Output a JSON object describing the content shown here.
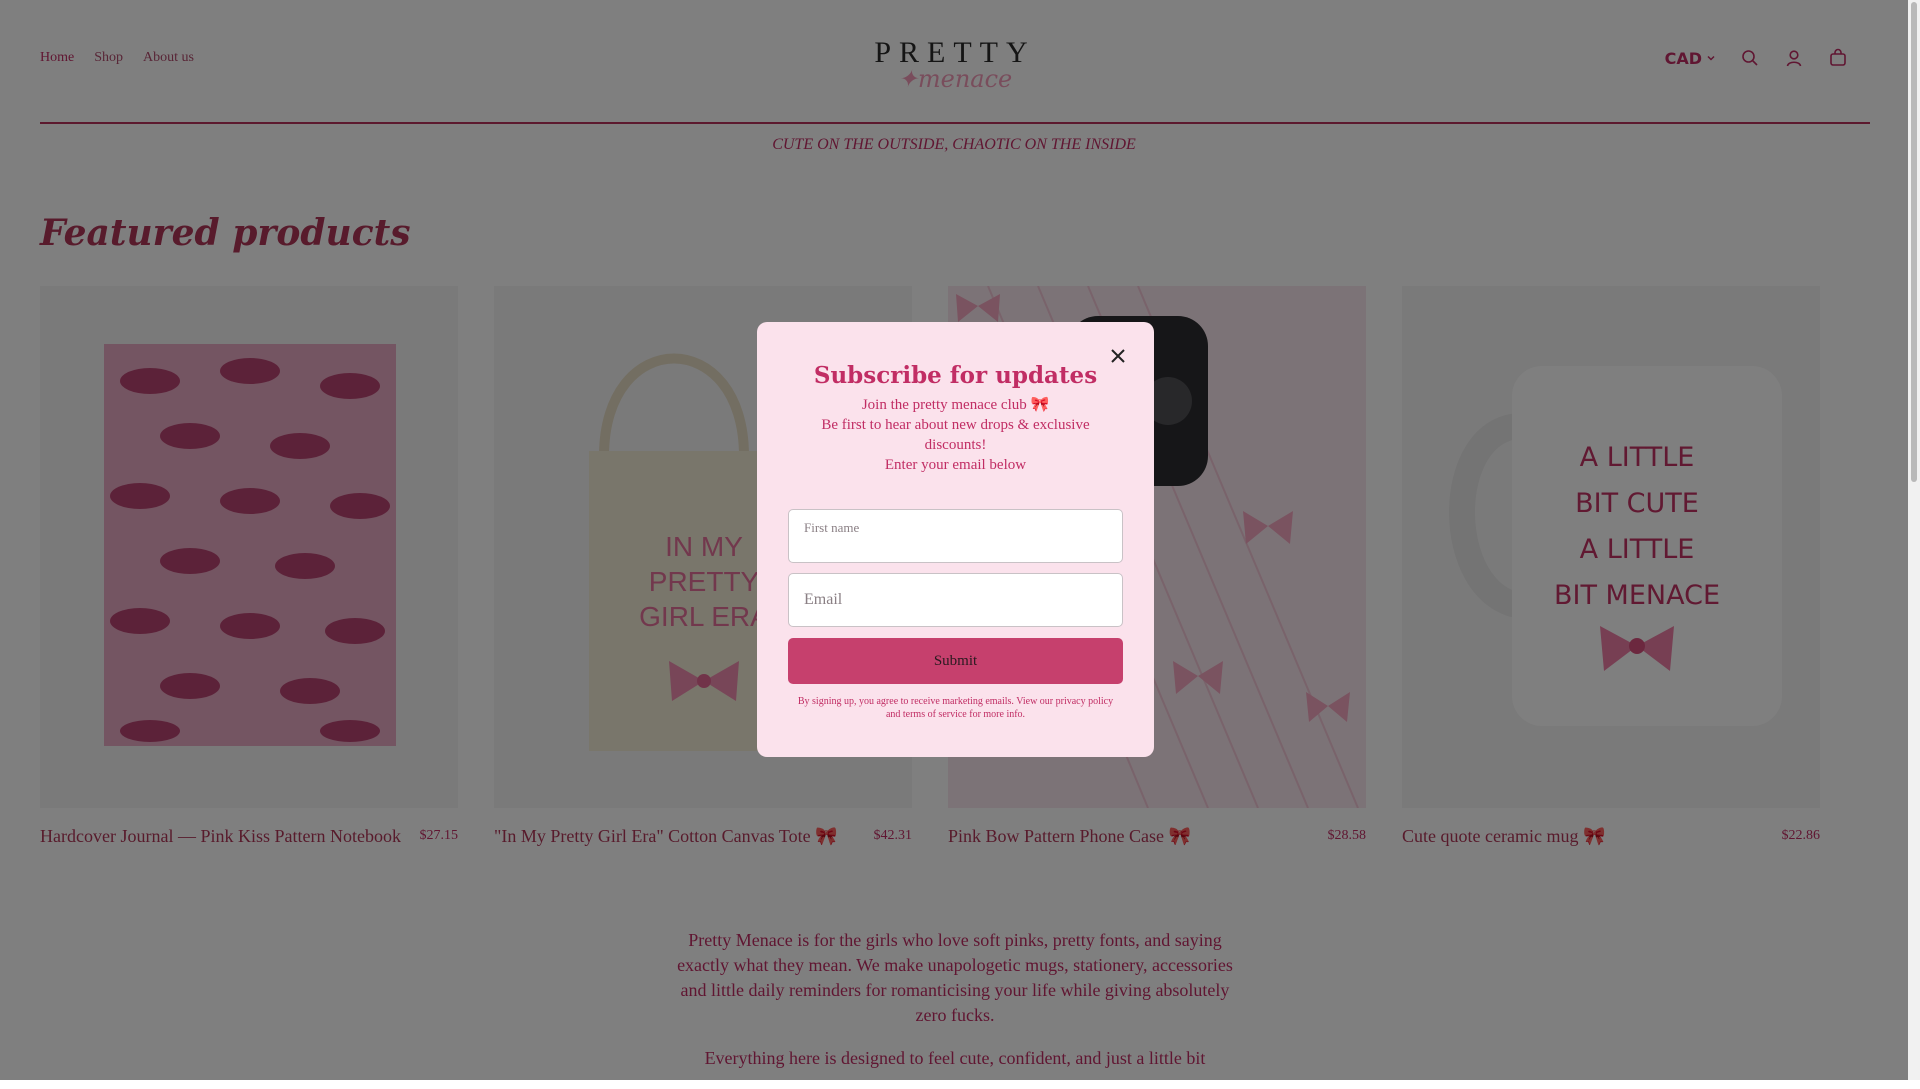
{
  "nav": {
    "home": "Home",
    "shop": "Shop",
    "about": "About us"
  },
  "logo": {
    "line1": "PRETTY",
    "line2": "✦menace"
  },
  "header": {
    "currency": "CAD"
  },
  "tagline": "CUTE ON THE OUTSIDE, CHAOTIC ON THE INSIDE",
  "section": {
    "title": "Featured products"
  },
  "products": [
    {
      "title": "Hardcover Journal — Pink Kiss Pattern Notebook",
      "price": "$27.15"
    },
    {
      "title": "\"In My Pretty Girl Era\" Cotton Canvas Tote 🎀",
      "price": "$42.31",
      "image_text": [
        "IN MY",
        "PRETTY",
        "GIRL ERA"
      ]
    },
    {
      "title": "Pink Bow Pattern Phone Case 🎀",
      "price": "$28.58"
    },
    {
      "title": "Cute quote ceramic mug 🎀",
      "price": "$22.86",
      "image_text": [
        "A LITTLE",
        "BIT CUTE",
        "A LITTLE",
        "BIT MENACE"
      ]
    }
  ],
  "about": {
    "p1": "Pretty Menace is for the girls who love soft pinks, pretty fonts, and saying exactly what they mean. We make unapologetic mugs, stationery, accessories and little daily reminders for romanticising your life while giving absolutely zero fucks.",
    "p2": "Everything here is designed to feel cute, confident, and just a little bit"
  },
  "modal": {
    "title": "Subscribe for updates",
    "line1": "Join the pretty menace club 🎀",
    "line2": "Be first to hear about new drops & exclusive discounts!",
    "line3": "Enter your email below",
    "first_name_placeholder": "First name",
    "email_placeholder": "Email",
    "submit": "Submit",
    "legal": "By signing up, you agree to receive marketing emails. View our privacy policy and terms of service for more info."
  },
  "colors": {
    "accent": "#c12d64",
    "button": "#c6406d",
    "modal_bg": "#fbe2ec"
  },
  "icons": [
    "search-icon",
    "account-icon",
    "cart-icon",
    "chevron-down-icon",
    "close-icon"
  ]
}
